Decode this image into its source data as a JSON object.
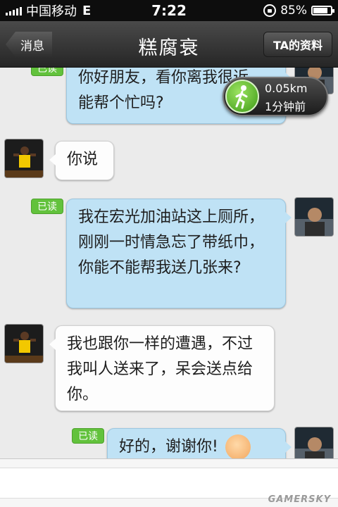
{
  "status_bar": {
    "carrier": "中国移动",
    "network": "E",
    "time": "7:22",
    "battery": "85%",
    "battery_level": 0.85
  },
  "nav": {
    "back_label": "消息",
    "title": "糕腐衰",
    "profile_label": "TA的资料"
  },
  "distance_badge": {
    "distance": "0.05km",
    "time_ago": "1分钟前"
  },
  "messages": [
    {
      "side": "out",
      "text": "你好朋友，看你离我很近，能帮个忙吗?",
      "read": "已读"
    },
    {
      "side": "in",
      "text": "你说"
    },
    {
      "side": "out",
      "text": "我在宏光加油站这上厕所，刚刚一时情急忘了带纸巾，你能不能帮我送几张来?",
      "read": "已读"
    },
    {
      "side": "in",
      "text": "我也跟你一样的遭遇，不过我叫人送来了，呆会送点给你。"
    },
    {
      "side": "out",
      "text": "好的，谢谢你!",
      "read": "已读"
    }
  ],
  "watermark": "GAMERSKY",
  "colors": {
    "outgoing_bubble": "#bfe2f5",
    "incoming_bubble": "#fdfdfd",
    "read_badge": "#62c23c",
    "nav_bar": "#333333"
  },
  "icons": [
    "signal-icon",
    "rotation-lock-icon",
    "battery-icon",
    "walking-person-icon",
    "smile-emoji-icon"
  ]
}
